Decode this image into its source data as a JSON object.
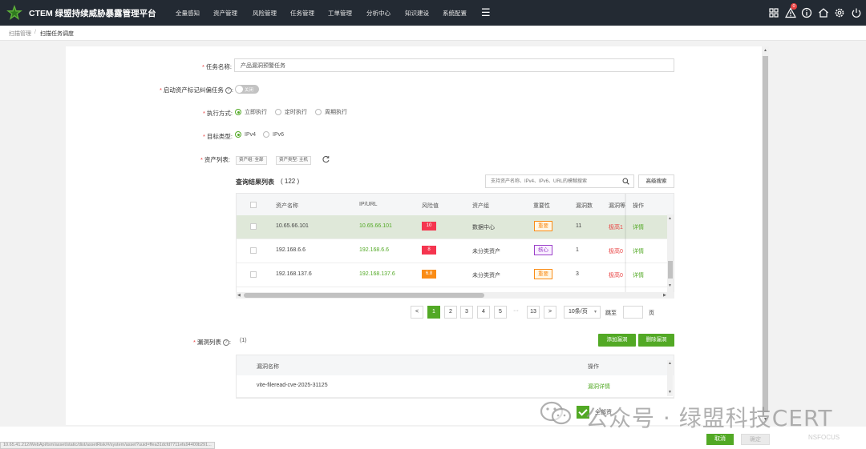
{
  "topbar": {
    "title": "CTEM 绿盟持续威胁暴露管理平台",
    "nav": [
      "全量感知",
      "资产管理",
      "风险管理",
      "任务管理",
      "工单管理",
      "分析中心",
      "知识建设",
      "系统配置"
    ],
    "badge_count": "0",
    "icons": [
      "apps-icon",
      "alert-icon",
      "info-icon",
      "home-icon",
      "settings-icon",
      "power-icon"
    ]
  },
  "breadcrumb": {
    "parent": "扫描管理",
    "separator": "/",
    "current": "扫描任务调度"
  },
  "form": {
    "task_name_label": "任务名称:",
    "task_name_value": "产品漏洞预警任务",
    "start_tag_label": "启动资产标记纠偏任务",
    "switch_text": "关闭",
    "exec_label": "执行方式:",
    "exec_options": [
      "立即执行",
      "定时执行",
      "周期执行"
    ],
    "target_label": "目标类型:",
    "target_options": [
      "IPv4",
      "IPv6"
    ],
    "asset_list_label": "资产列表:",
    "tags": [
      "资产组: 全部",
      "资产类型: 主机"
    ]
  },
  "results": {
    "title": "查询结果列表",
    "count": "( 122 )",
    "search_placeholder": "支持资产名称、IPv4、IPv6、URL的模糊搜索",
    "advanced_search": "高级搜索",
    "columns": [
      "资产名称",
      "IP/URL",
      "风险值",
      "资产组",
      "重要性",
      "漏洞数",
      "漏洞等",
      "操作"
    ],
    "rows": [
      {
        "name": "10.65.66.101",
        "ip": "10.65.66.101",
        "risk": "10",
        "risk_color": "#f5354f",
        "group": "数据中心",
        "importance": "重要",
        "imp_style": "orange",
        "vuln_count": "11",
        "level": "极高1",
        "action": "详情"
      },
      {
        "name": "192.168.6.6",
        "ip": "192.168.6.6",
        "risk": "8",
        "risk_color": "#f5354f",
        "group": "未分类资产",
        "importance": "核心",
        "imp_style": "purple",
        "vuln_count": "1",
        "level": "极高0",
        "action": "详情"
      },
      {
        "name": "192.168.137.6",
        "ip": "192.168.137.6",
        "risk": "6.8",
        "risk_color": "#fa8c16",
        "group": "未分类资产",
        "importance": "重要",
        "imp_style": "orange",
        "vuln_count": "3",
        "level": "极高0",
        "action": "详情"
      }
    ]
  },
  "pagination": {
    "prev": "<",
    "next": ">",
    "pages": [
      "1",
      "2",
      "3",
      "4",
      "5"
    ],
    "ellipsis": "···",
    "last": "13",
    "current": "1",
    "page_size": "10条/页",
    "jump_label": "跳至",
    "page_suffix": "页"
  },
  "vulns": {
    "label": "漏洞列表",
    "count": "(1)",
    "add_button": "添加漏洞",
    "delete_button": "删除漏洞",
    "columns": [
      "漏洞名称",
      "操作"
    ],
    "rows": [
      {
        "name": "vite-fileread-cve-2025-31125",
        "action": "漏洞详情"
      }
    ]
  },
  "behind_text": "全部资",
  "footer": {
    "cancel": "取消",
    "ok": "确定"
  },
  "status_url": "10.65.41.212/WebApi/tsm/asset/static/dist/assetRisk/#/system/asset?uuid=ffea31dcfd7711efa94400b291...",
  "watermark": {
    "text": "公众号 · 绿盟科技CERT",
    "sub": "NSFOCUS"
  },
  "colors": {
    "primary": "#52a925",
    "nav_bg": "#232a33",
    "danger": "#e94141"
  }
}
